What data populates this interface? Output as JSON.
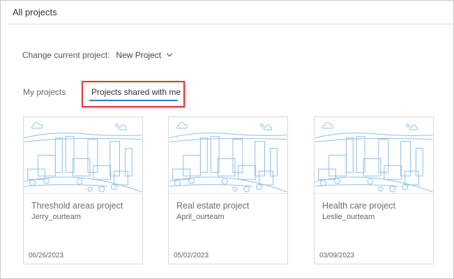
{
  "header": {
    "title": "All projects"
  },
  "current_project": {
    "label": "Change current project:",
    "value": "New Project"
  },
  "tabs": [
    {
      "label": "My projects",
      "active": false
    },
    {
      "label": "Projects shared with me",
      "active": true
    }
  ],
  "colors": {
    "accent": "#2f7cc4",
    "highlight": "#e0383e",
    "illustration": "#8cc0e8"
  },
  "projects": [
    {
      "name": "Threshold areas project",
      "owner": "Jerry_ourteam",
      "date": "06/26/2023"
    },
    {
      "name": "Real estate project",
      "owner": "April_ourteam",
      "date": "05/02/2023"
    },
    {
      "name": "Health care project",
      "owner": "Leslie_ourteam",
      "date": "03/09/2023"
    }
  ]
}
